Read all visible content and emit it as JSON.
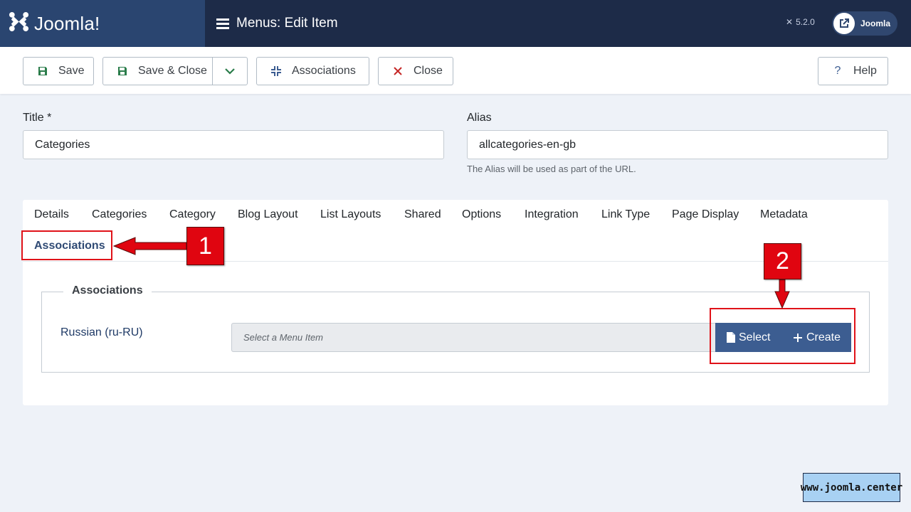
{
  "header": {
    "brand_name": "Joomla!",
    "page_title": "Menus: Edit Item",
    "version": "5.2.0",
    "user_button_label": "Joomla"
  },
  "toolbar": {
    "save_label": "Save",
    "save_close_label": "Save & Close",
    "associations_label": "Associations",
    "close_label": "Close",
    "help_label": "Help"
  },
  "form": {
    "title_label": "Title *",
    "title_value": "Categories",
    "alias_label": "Alias",
    "alias_value": "allcategories-en-gb",
    "alias_hint": "The Alias will be used as part of the URL."
  },
  "tabs": [
    {
      "label": "Details"
    },
    {
      "label": "Categories"
    },
    {
      "label": "Category"
    },
    {
      "label": "Blog Layout"
    },
    {
      "label": "List Layouts"
    },
    {
      "label": "Shared"
    },
    {
      "label": "Options"
    },
    {
      "label": "Integration"
    },
    {
      "label": "Link Type"
    },
    {
      "label": "Page Display"
    },
    {
      "label": "Metadata"
    },
    {
      "label": "Associations",
      "active": true
    }
  ],
  "associations": {
    "legend": "Associations",
    "language_label": "Russian (ru-RU)",
    "menu_item_placeholder": "Select a Menu Item",
    "select_label": "Select",
    "create_label": "Create"
  },
  "annotations": {
    "marker_1": "1",
    "marker_2": "2"
  },
  "watermark": "www.joomla.center",
  "colors": {
    "header_bg": "#1d2b48",
    "brand_bg": "#2a4570",
    "action_blue": "#3c5d91",
    "annotation_red": "#e00510",
    "save_green": "#2a7c4a",
    "close_red": "#c52827"
  },
  "icons": {
    "brand": "joomla-logo-icon",
    "title": "list-icon",
    "save": "floppy-disk-icon",
    "dropdown": "chevron-down-icon",
    "associations": "compress-icon",
    "close": "times-icon",
    "help": "question-icon",
    "user": "external-link-icon",
    "select": "file-icon",
    "create": "plus-icon"
  }
}
